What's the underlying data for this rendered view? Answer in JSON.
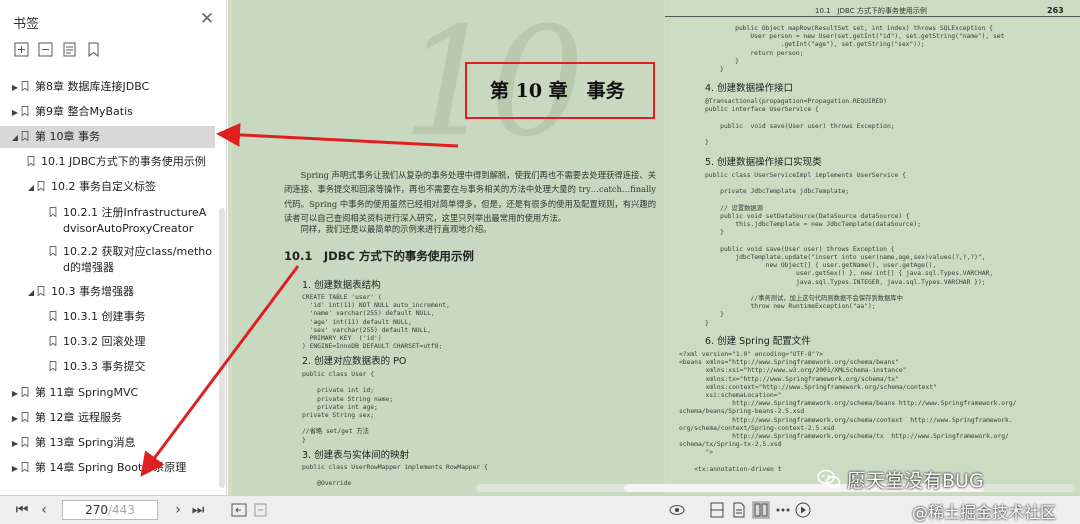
{
  "sidebar": {
    "title": "书签",
    "close_icon": "close-icon",
    "tools": [
      "expand-all-icon",
      "collapse-all-icon",
      "bookmark-options-icon",
      "bookmark-add-icon"
    ],
    "items": [
      {
        "label": "第8章 数据库连接JDBC",
        "toggle": "▶",
        "selected": false
      },
      {
        "label": "第9章 整合MyBatis",
        "toggle": "▶",
        "selected": false
      },
      {
        "label": "第 10章 事务",
        "toggle": "◢",
        "selected": true
      },
      {
        "label": "10.1 JDBC方式下的事务使用示例",
        "toggle": "",
        "selected": false
      },
      {
        "label": "10.2 事务自定义标签",
        "toggle": "◢",
        "selected": false
      },
      {
        "label": "10.2.1 注册InfrastructureAdvisorAutoProxyCreator",
        "toggle": "",
        "selected": false
      },
      {
        "label": "10.2.2 获取对应class/method的增强器",
        "toggle": "",
        "selected": false
      },
      {
        "label": "10.3 事务增强器",
        "toggle": "◢",
        "selected": false
      },
      {
        "label": "10.3.1 创建事务",
        "toggle": "",
        "selected": false
      },
      {
        "label": "10.3.2 回滚处理",
        "toggle": "",
        "selected": false
      },
      {
        "label": "10.3.3 事务提交",
        "toggle": "",
        "selected": false
      },
      {
        "label": "第 11章 SpringMVC",
        "toggle": "▶",
        "selected": false
      },
      {
        "label": "第 12章 远程服务",
        "toggle": "▶",
        "selected": false
      },
      {
        "label": "第 13章 Spring消息",
        "toggle": "▶",
        "selected": false
      },
      {
        "label": "第 14章 Spring Boot体系原理",
        "toggle": "▶",
        "selected": false
      }
    ]
  },
  "document": {
    "left_page": {
      "watermark": "10",
      "chapter_title": "第 10 章　事务",
      "intro_paragraph": "Spring 声明式事务让我们从复杂的事务处理中得到解脱，使我们再也不需要去处理获得连接、关闭连接、事务提交和回滚等操作，再也不需要在与事务相关的方法中处理大量的 try…catch…finally 代码。Spring 中事务的使用虽然已经相对简单得多，但是，还是有很多的使用及配置规则，有兴趣的读者可以自己查阅相关资料进行深入研究，这里只列举出最常用的使用方法。",
      "intro_paragraph_2": "同样，我们还是以最简单的示例来进行直观地介绍。",
      "section_title": "10.1　JDBC 方式下的事务使用示例",
      "step1": "1. 创建数据表结构",
      "code1": "CREATE TABLE 'user' (\n  'id' int(11) NOT NULL auto_increment,\n  'name' varchar(255) default NULL,\n  'age' int(11) default NULL,\n  'sex' varchar(255) default NULL,\n  PRIMARY KEY  ('id')\n) ENGINE=InnoDB DEFAULT CHARSET=utf8;",
      "step2": "2. 创建对应数据表的 PO",
      "code2": "public class User {\n\n    private int id;\n    private String name;\n    private int age;\nprivate String sex;\n\n//省略 set/get 方法\n}",
      "step3": "3. 创建表与实体间的映射",
      "code3": "public class UserRowMapper implements RowMapper {\n\n    @Override"
    },
    "right_page": {
      "header": "10.1　JDBC 方式下的事务使用示例",
      "page_number": "263",
      "code_top": "    public Object mapRow(ResultSet set, int index) throws SQLException {\n        User person = new User(set.getInt(\"id\"), set.getString(\"name\"), set\n                .getInt(\"age\"), set.getString(\"sex\"));\n        return person;\n    }\n}",
      "step4": "4. 创建数据操作接口",
      "code4": "@Transactional(propagation=Propagation.REQUIRED)\npublic interface UserService {\n\n    public  void save(User user) throws Exception;\n\n}",
      "step5": "5. 创建数据操作接口实现类",
      "code5": "public class UserServiceImpl implements UserService {\n\n    private JdbcTemplate jdbcTemplate;\n\n    // 设置数据源\n    public void setDataSource(DataSource dataSource) {\n        this.jdbcTemplate = new JdbcTemplate(dataSource);\n    }\n\n    public void save(User user) throws Exception {\n        jdbcTemplate.update(\"insert into user(name,age,sex)values(?,?,?)\",\n                new Object[] { user.getName(), user.getAge(),\n                        user.getSex() }, new int[] { java.sql.Types.VARCHAR,\n                        java.sql.Types.INTEGER, java.sql.Types.VARCHAR });\n\n            //事务测试，加上这句代码则数据不会保存到数据库中\n            throw new RuntimeException(\"aa\");\n    }\n}",
      "step6": "6. 创建 Spring 配置文件",
      "code6": "<?xml version=\"1.0\" encoding=\"UTF-8\"?>\n<beans xmlns=\"http://www.Springframework.org/schema/beans\"\n       xmlns:xsi=\"http://www.w3.org/2001/XMLSchema-instance\"\n       xmlns:tx=\"http://www.Springframework.org/schema/tx\"\n       xmlns:context=\"http://www.Springframework.org/schema/context\"\n       xsi:schemaLocation=\"\n              http://www.Springframework.org/schema/beans http://www.Springframework.org/\nschema/beans/Spring-beans-2.5.xsd\n              http://www.Springframework.org/schema/context  http://www.Springframework.\norg/schema/context/Spring-context-2.5.xsd\n              http://www.Springframework.org/schema/tx  http://www.Springframework.org/\nschema/tx/Spring-tx-2.5.xsd\n       \">\n\n    <tx:annotation-driven t"
    }
  },
  "toolbar": {
    "first_page_icon": "first-page-icon",
    "prev_page_icon": "previous-page-icon",
    "current_page": "270",
    "total_pages": "/443",
    "next_page_icon": "next-page-icon",
    "last_page_icon": "last-page-icon",
    "view_icons": [
      "fit-page-icon",
      "copy-icon",
      "reading-mode-icon",
      "single-page-icon",
      "document-page-icon",
      "two-page-icon",
      "more-icon",
      "play-icon"
    ]
  },
  "overlays": {
    "wechat_watermark": "愿天堂没有BUG",
    "juejin_watermark": "@稀土掘金技术社区"
  },
  "colors": {
    "annotation_red": "#e02020",
    "page_green": "#c9d8c0",
    "selected_item": "#d8d8d8"
  }
}
